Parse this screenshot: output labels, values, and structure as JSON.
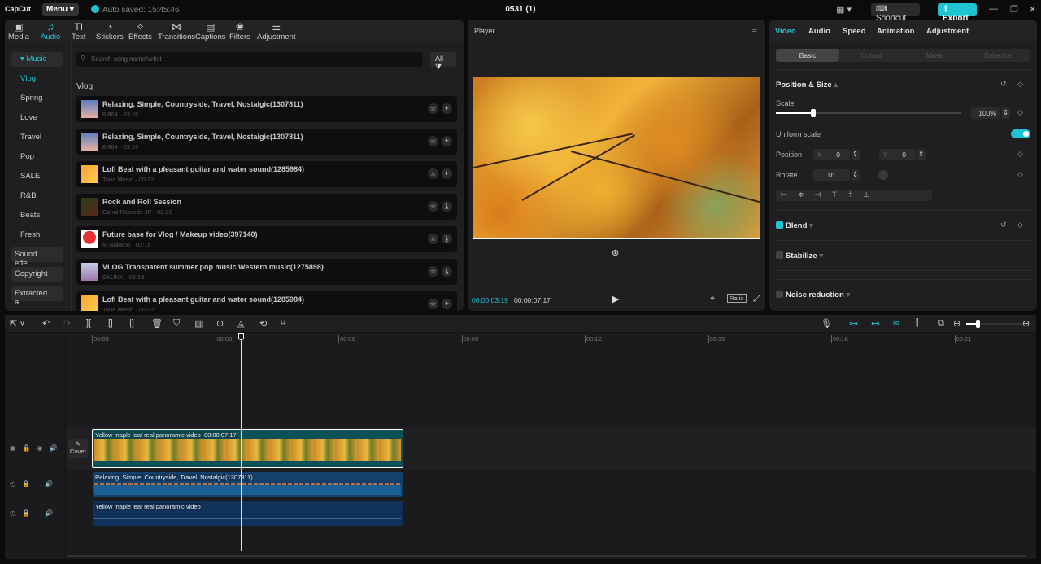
{
  "app": {
    "logo": "CapCut",
    "menu": "Menu",
    "autosave": "Auto saved: 15:45:46",
    "title": "0531 (1)",
    "shortcut": "Shortcut",
    "export": "Export"
  },
  "toolbar": [
    {
      "label": "Media",
      "icon": "▣"
    },
    {
      "label": "Audio",
      "icon": "♫"
    },
    {
      "label": "Text",
      "icon": "TI"
    },
    {
      "label": "Stickers",
      "icon": "◔"
    },
    {
      "label": "Effects",
      "icon": "✧"
    },
    {
      "label": "Transitions",
      "icon": "⋈"
    },
    {
      "label": "Captions",
      "icon": "▤"
    },
    {
      "label": "Filters",
      "icon": "❀"
    },
    {
      "label": "Adjustment",
      "icon": "⚌"
    }
  ],
  "sidebar": {
    "items": [
      "▾ Music",
      "Vlog",
      "Spring",
      "Love",
      "Travel",
      "Pop",
      "SALE",
      "R&B",
      "Beats",
      "Fresh",
      "Sound effe...",
      "Copyright",
      "Extracted a..."
    ]
  },
  "library": {
    "search_placeholder": "Search song name/artist",
    "filter": "All",
    "section": "Vlog",
    "songs": [
      {
        "title": "Relaxing, Simple, Countryside, Travel, Nostalgic(1307811)",
        "meta": "8.864 · 03:15",
        "action": "+"
      },
      {
        "title": "Relaxing, Simple, Countryside, Travel, Nostalgic(1307811)",
        "meta": "8.864 · 03:15",
        "action": "+"
      },
      {
        "title": "Lofi Beat with a pleasant guitar and water sound(1285984)",
        "meta": "Tana Music · 00:32",
        "action": "+"
      },
      {
        "title": "Rock and Roll Session",
        "meta": "Canal Records JP · 02:20",
        "action": "⤓"
      },
      {
        "title": "Future base for Vlog / Makeup video(397140)",
        "meta": "M.Nakano · 03:16",
        "action": "⤓"
      },
      {
        "title": "VLOG Transparent summer pop music Western music(1275898)",
        "meta": "SKUNK · 03:19",
        "action": "⤓"
      },
      {
        "title": "Lofi Beat with a pleasant guitar and water sound(1285984)",
        "meta": "Tana Music · 00:32",
        "action": "+"
      }
    ]
  },
  "player": {
    "title": "Player",
    "current": "00:00:03:19",
    "total": "00:00:07:17",
    "ratio": "Ratio"
  },
  "inspector": {
    "tabs": [
      "Video",
      "Audio",
      "Speed",
      "Animation",
      "Adjustment"
    ],
    "subtabs": [
      "Basic",
      "Cutout",
      "Mask",
      "Enhance"
    ],
    "position_size": "Position & Size",
    "scale_label": "Scale",
    "scale_value": "100%",
    "scale_fraction": 0.2,
    "uniform_scale": "Uniform scale",
    "uniform_on": true,
    "position_label": "Position",
    "x_label": "X",
    "x": "0",
    "y_label": "Y",
    "y": "0",
    "rotate_label": "Rotate",
    "rotate": "0°",
    "blend": "Blend",
    "blend_on": true,
    "stabilize": "Stabilize",
    "noise": "Noise reduction"
  },
  "timeline": {
    "ticks": [
      "00:00",
      "00:03",
      "00:06",
      "00:09",
      "00:12",
      "00:15",
      "00:18",
      "00:21"
    ],
    "cover": "Cover",
    "video_clip": "Yellow maple leaf real panoramic video",
    "video_duration": "00:00:07:17",
    "audio_clip": "Relaxing, Simple, Countryside, Travel, Nostalgic(1307811)",
    "audio_clip2": "Yellow maple leaf real panoramic video"
  },
  "colors": {
    "accent": "#1fc3d2"
  }
}
